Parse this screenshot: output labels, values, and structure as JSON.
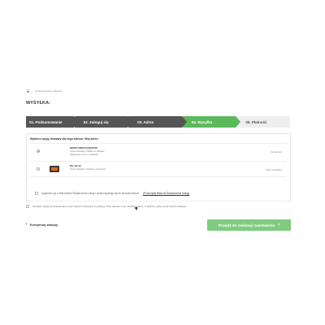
{
  "breadcrumb": {
    "home_icon": "home-icon",
    "separator": "›",
    "current": "Podsumowanie zakupów"
  },
  "page_title": "WYSYŁKA:",
  "steps": [
    {
      "label": "01. Podsumowanie",
      "state": "done"
    },
    {
      "label": "02. Zaloguj się",
      "state": "done"
    },
    {
      "label": "03. Adres",
      "state": "done"
    },
    {
      "label": "04. Wysyłka",
      "state": "active"
    },
    {
      "label": "05. Płatność",
      "state": "pending"
    }
  ],
  "shipping": {
    "header": "Wybierz opcję dostawy dla tego adresu: Mój adres",
    "options": [
      {
        "selected": true,
        "name": "DEMO-PRESTASHOP.PL",
        "line1": "Czas dostawy: Odbiór w sklepie",
        "line2": "Najlepsza cena i szybkość",
        "price": "Za darmo!"
      },
      {
        "selected": false,
        "name": "My carrier",
        "line1": "Czas dostawy: Delivery next day!",
        "line2": "",
        "price": "9,51 zł (brutto)",
        "logo": "carrier-logo"
      }
    ],
    "terms_text": "Zgadzam się z Warunkami Świadczenia Usług i podporządkuję się im bezwarunkowo.",
    "terms_link": "(Przeczytaj Warunki Świadczenia Usług)"
  },
  "consent_text": "Wyrażam zgodę na przetwarzanie moich danych osobowych w podanym niżej zakresie: imię, nazwisko, adres, nr telefonu, adres email, historia zakupów.",
  "back_label": "Kontynuuj zakupy",
  "proceed_label": "Przejdź do realizacji zamówienia",
  "colors": {
    "active_step": "#5cb85c",
    "dark_step": "#555555",
    "proceed_button": "#7fcb7f"
  }
}
